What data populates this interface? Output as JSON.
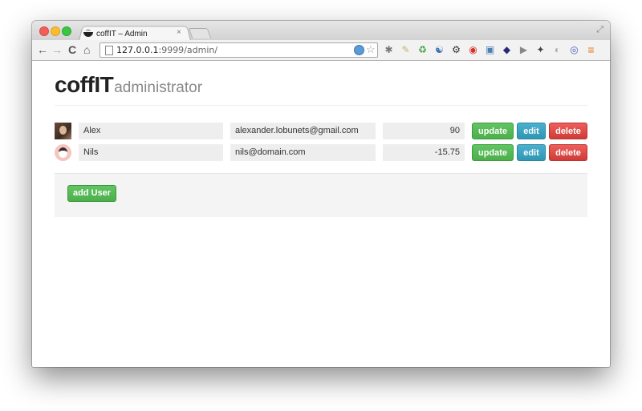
{
  "browser": {
    "tab_title": "coffIT – Admin",
    "tab_close": "×",
    "url_host": "127.0.0.1",
    "url_rest": ":9999/admin/",
    "nav": {
      "back": "←",
      "forward": "→",
      "reload": "C",
      "home": "⌂"
    },
    "extensions": [
      "✱",
      "✎",
      "♻",
      "☯",
      "⚙",
      "◉",
      "▣",
      "◆",
      "▶",
      "✦",
      "◐",
      "◎",
      "≡"
    ]
  },
  "header": {
    "brand": "coffIT",
    "subtitle": "administrator"
  },
  "users": [
    {
      "name": "Alex",
      "email": "alexander.lobunets@gmail.com",
      "score": "90",
      "update_label": "update",
      "edit_label": "edit",
      "delete_label": "delete"
    },
    {
      "name": "Nils",
      "email": "nils@domain.com",
      "score": "-15.75",
      "update_label": "update",
      "edit_label": "edit",
      "delete_label": "delete"
    }
  ],
  "actions": {
    "add_user_label": "add User"
  },
  "colors": {
    "success": "#5bb75b",
    "info": "#49afcd",
    "danger": "#da4f49"
  }
}
